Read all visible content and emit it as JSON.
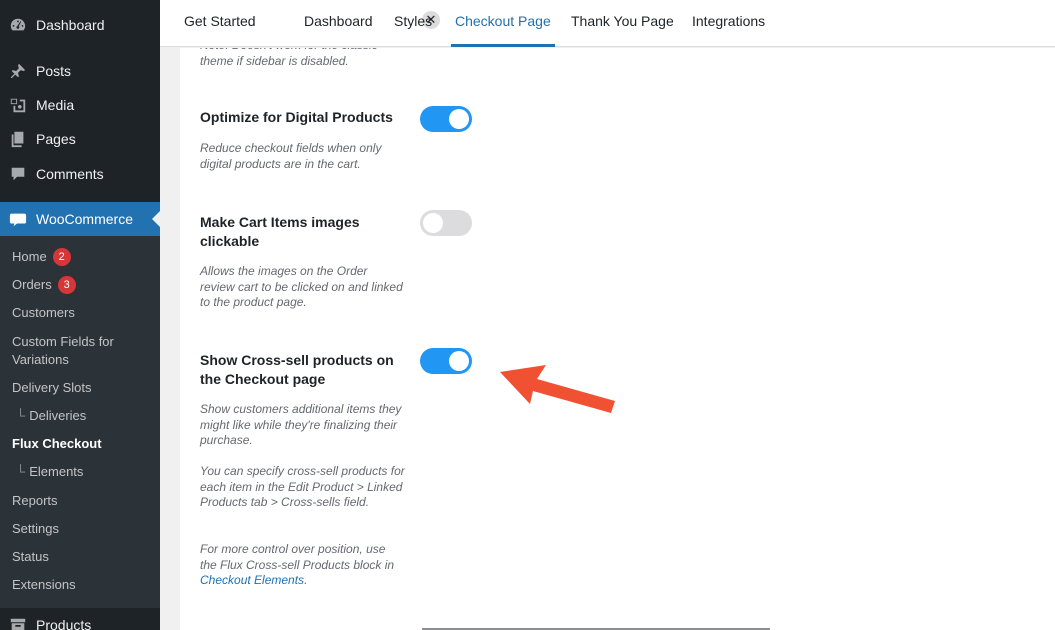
{
  "sidebar": {
    "menu": [
      {
        "label": "Dashboard",
        "icon": "dashboard-icon"
      },
      {
        "label": "Posts",
        "icon": "pushpin-icon"
      },
      {
        "label": "Media",
        "icon": "media-icon"
      },
      {
        "label": "Pages",
        "icon": "pages-icon"
      },
      {
        "label": "Comments",
        "icon": "comment-icon"
      },
      {
        "label": "WooCommerce",
        "icon": "woo-icon"
      }
    ],
    "submenu": [
      {
        "label": "Home",
        "badge": "2"
      },
      {
        "label": "Orders",
        "badge": "3"
      },
      {
        "label": "Customers"
      },
      {
        "label": "Custom Fields for Variations"
      },
      {
        "label": "Delivery Slots"
      },
      {
        "label": "Deliveries",
        "prefix": "└"
      },
      {
        "label": "Flux Checkout"
      },
      {
        "label": "Elements",
        "prefix": "└"
      },
      {
        "label": "Reports"
      },
      {
        "label": "Settings"
      },
      {
        "label": "Status"
      },
      {
        "label": "Extensions"
      }
    ],
    "products_label": "Products"
  },
  "tabs": [
    {
      "label": "Get Started"
    },
    {
      "label": "Dashboard"
    },
    {
      "label": "Styles"
    },
    {
      "label": "Checkout Page"
    },
    {
      "label": "Thank You Page"
    },
    {
      "label": "Integrations"
    }
  ],
  "tab_close_glyph": "✕",
  "settings": {
    "partial_desc": "Note: Doesn't work for the classic theme if sidebar is disabled.",
    "optimize": {
      "label": "Optimize for Digital Products",
      "desc": "Reduce checkout fields when only digital products are in the cart.",
      "enabled": true
    },
    "cart_images": {
      "label": "Make Cart Items images clickable",
      "desc": "Allows the images on the Order review cart to be clicked on and linked to the product page.",
      "enabled": false
    },
    "cross_sell": {
      "label": "Show Cross-sell products on the Checkout page",
      "desc1": "Show customers additional items they might like while they're finalizing their purchase.",
      "desc2": "You can specify cross-sell products for each item in the Edit Product > Linked Products tab > Cross-sells field.",
      "desc3_prefix": "For more control over position, use the Flux Cross-sell Products block in ",
      "desc3_link": "Checkout Elements",
      "desc3_suffix": ".",
      "enabled": true
    }
  },
  "colors": {
    "accent": "#2271b1",
    "toggle_on": "#2196f3",
    "arrow": "#f05133",
    "sidebar_bg": "#1d2327"
  }
}
